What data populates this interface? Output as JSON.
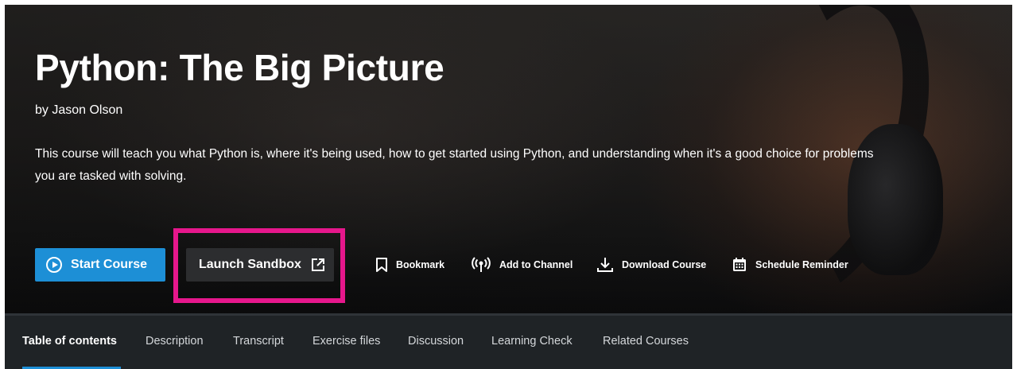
{
  "course": {
    "title": "Python: The Big Picture",
    "author": "by Jason Olson",
    "description": "This course will teach you what Python is, where it's being used, how to get started using Python, and understanding when it's a good choice for problems you are tasked with solving."
  },
  "actions": {
    "start_course": "Start Course",
    "launch_sandbox": "Launch Sandbox",
    "bookmark": "Bookmark",
    "add_to_channel": "Add to Channel",
    "download_course": "Download Course",
    "schedule_reminder": "Schedule Reminder"
  },
  "tabs": [
    {
      "label": "Table of contents",
      "active": true
    },
    {
      "label": "Description",
      "active": false
    },
    {
      "label": "Transcript",
      "active": false
    },
    {
      "label": "Exercise files",
      "active": false
    },
    {
      "label": "Discussion",
      "active": false
    },
    {
      "label": "Learning Check",
      "active": false
    },
    {
      "label": "Related Courses",
      "active": false
    }
  ],
  "icons": {
    "start": "play-circle-icon",
    "sandbox": "external-link-icon",
    "bookmark": "bookmark-icon",
    "channel": "broadcast-icon",
    "download": "download-icon",
    "schedule": "calendar-icon"
  },
  "colors": {
    "primary": "#1d8fd6",
    "highlight": "#e6178c",
    "tabbar": "#1f2326",
    "sandbox_button": "#2c2d2f"
  }
}
